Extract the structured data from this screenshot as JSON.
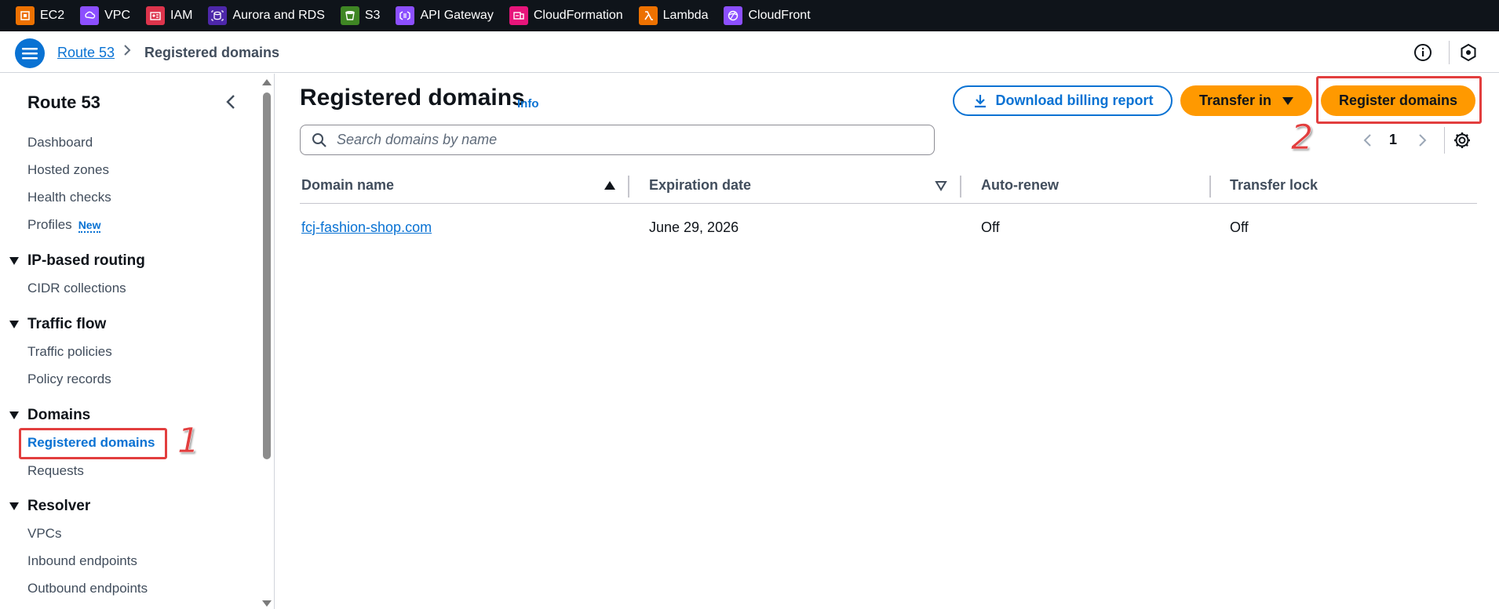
{
  "favorites": [
    {
      "label": "EC2",
      "icon": "ec2-icon",
      "color": "#ed7100"
    },
    {
      "label": "VPC",
      "icon": "vpc-icon",
      "color": "#8c4fff"
    },
    {
      "label": "IAM",
      "icon": "iam-icon",
      "color": "#dd344c"
    },
    {
      "label": "Aurora and RDS",
      "icon": "rds-icon",
      "color": "#4d27aa"
    },
    {
      "label": "S3",
      "icon": "s3-icon",
      "color": "#3f8624"
    },
    {
      "label": "API Gateway",
      "icon": "api-gateway-icon",
      "color": "#8c4fff"
    },
    {
      "label": "CloudFormation",
      "icon": "cloudformation-icon",
      "color": "#e7157b"
    },
    {
      "label": "Lambda",
      "icon": "lambda-icon",
      "color": "#ed7100"
    },
    {
      "label": "CloudFront",
      "icon": "cloudfront-icon",
      "color": "#8c4fff"
    }
  ],
  "breadcrumb": {
    "parent": "Route 53",
    "current": "Registered domains"
  },
  "sidebar": {
    "title": "Route 53",
    "items": {
      "dashboard": "Dashboard",
      "hosted_zones": "Hosted zones",
      "health_checks": "Health checks",
      "profiles": "Profiles",
      "profiles_badge": "New",
      "ip_routing": "IP-based routing",
      "cidr": "CIDR collections",
      "traffic_flow": "Traffic flow",
      "traffic_policies": "Traffic policies",
      "policy_records": "Policy records",
      "domains": "Domains",
      "registered_domains": "Registered domains",
      "requests": "Requests",
      "resolver": "Resolver",
      "vpcs": "VPCs",
      "inbound": "Inbound endpoints",
      "outbound": "Outbound endpoints"
    }
  },
  "main": {
    "title": "Registered domains",
    "info": "Info",
    "download_btn": "Download billing report",
    "transfer_btn": "Transfer in",
    "register_btn": "Register domains",
    "search_placeholder": "Search domains by name",
    "page_number": "1",
    "columns": {
      "domain": "Domain name",
      "expiration": "Expiration date",
      "autorenew": "Auto-renew",
      "lock": "Transfer lock"
    },
    "rows": [
      {
        "domain": "fcj-fashion-shop.com",
        "expiration": "June 29, 2026",
        "autorenew": "Off",
        "lock": "Off"
      }
    ]
  },
  "annotations": {
    "step1": "1",
    "step2": "2"
  },
  "colors": {
    "accent": "#0972d3",
    "primary_button": "#ff9900",
    "annotation": "#e23e3e",
    "topbar": "#0f141a"
  }
}
